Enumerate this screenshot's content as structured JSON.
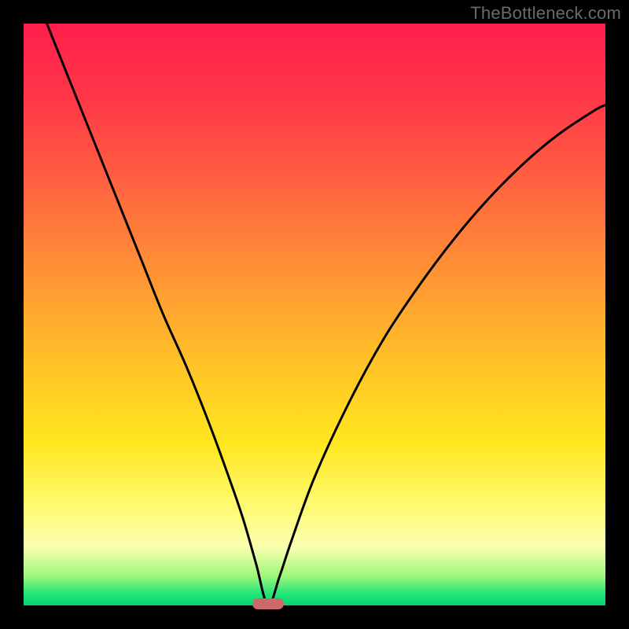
{
  "watermark": "TheBottleneck.com",
  "colors": {
    "frame_bg": "#000000",
    "curve": "#000000",
    "marker": "#cc6a6b",
    "gradient_stops": [
      "#ff1e4c",
      "#ff3a47",
      "#ff6a3e",
      "#ff9a33",
      "#ffc726",
      "#ffe61f",
      "#fff96a",
      "#fbffb0",
      "#9cf77a",
      "#22e57a",
      "#07d46a"
    ]
  },
  "chart_data": {
    "type": "line",
    "title": "",
    "xlabel": "",
    "ylabel": "",
    "xlim": [
      0,
      100
    ],
    "ylim": [
      0,
      100
    ],
    "note": "x is horizontal position (percent of plot width), y is bottleneck magnitude (percent, 0=green/good at bottom, 100=red/bad at top). Curve minimum ≈ x=42 marks balance point; marker sits there.",
    "series": [
      {
        "name": "bottleneck-curve",
        "x": [
          4,
          8,
          12,
          16,
          20,
          24,
          28,
          32,
          36,
          38,
          40,
          42,
          44,
          46,
          50,
          56,
          62,
          68,
          74,
          80,
          86,
          92,
          98,
          100
        ],
        "y": [
          100,
          90,
          80,
          70,
          60,
          50,
          41,
          31,
          20,
          14,
          7,
          0,
          5,
          11,
          22,
          35,
          46,
          55,
          63,
          70,
          76,
          81,
          85,
          86
        ]
      }
    ],
    "marker": {
      "x": 42,
      "y": 0,
      "width_pct": 5.4,
      "height_pct": 1.9
    }
  }
}
